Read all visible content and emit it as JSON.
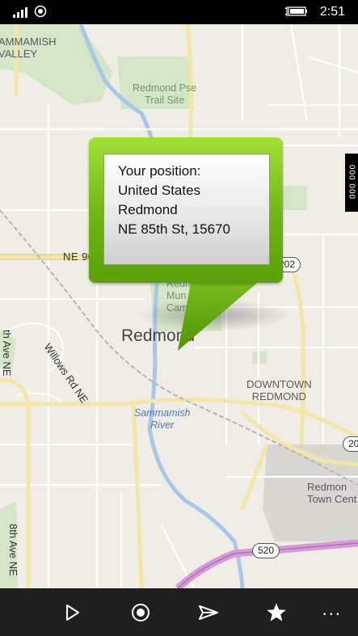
{
  "status_bar": {
    "time": "2:51"
  },
  "map": {
    "area_labels": {
      "sammamish_valley": "AMMAMISH\nVALLEY",
      "trail_site": "Redmond Pse\nTrail Site",
      "municipal_campus": "Redm\nMun\nCampus",
      "city": "Redmond",
      "downtown": "DOWNTOWN\nREDMOND",
      "river": "Sammamish\nRiver",
      "town_center": "Redmon\nTown Cent"
    },
    "roads": {
      "ne_90th": "NE 90th St",
      "willows": "Willows Rd NE",
      "ave_ne_top": "th Ave NE",
      "ave_ne_bottom": "8th Ave NE"
    },
    "shields": {
      "sr202": "202",
      "sr520": "520",
      "sr20": "20"
    }
  },
  "callout": {
    "line1": "Your position:",
    "line2": "United States",
    "line3": "Redmond",
    "line4": "NE 85th St, 15670",
    "color": "#7cc21e"
  },
  "side_tab": {
    "text": "000 000"
  },
  "appbar": {
    "buttons": [
      "play-icon",
      "record-icon",
      "send-icon",
      "star-icon"
    ],
    "more": "..."
  }
}
